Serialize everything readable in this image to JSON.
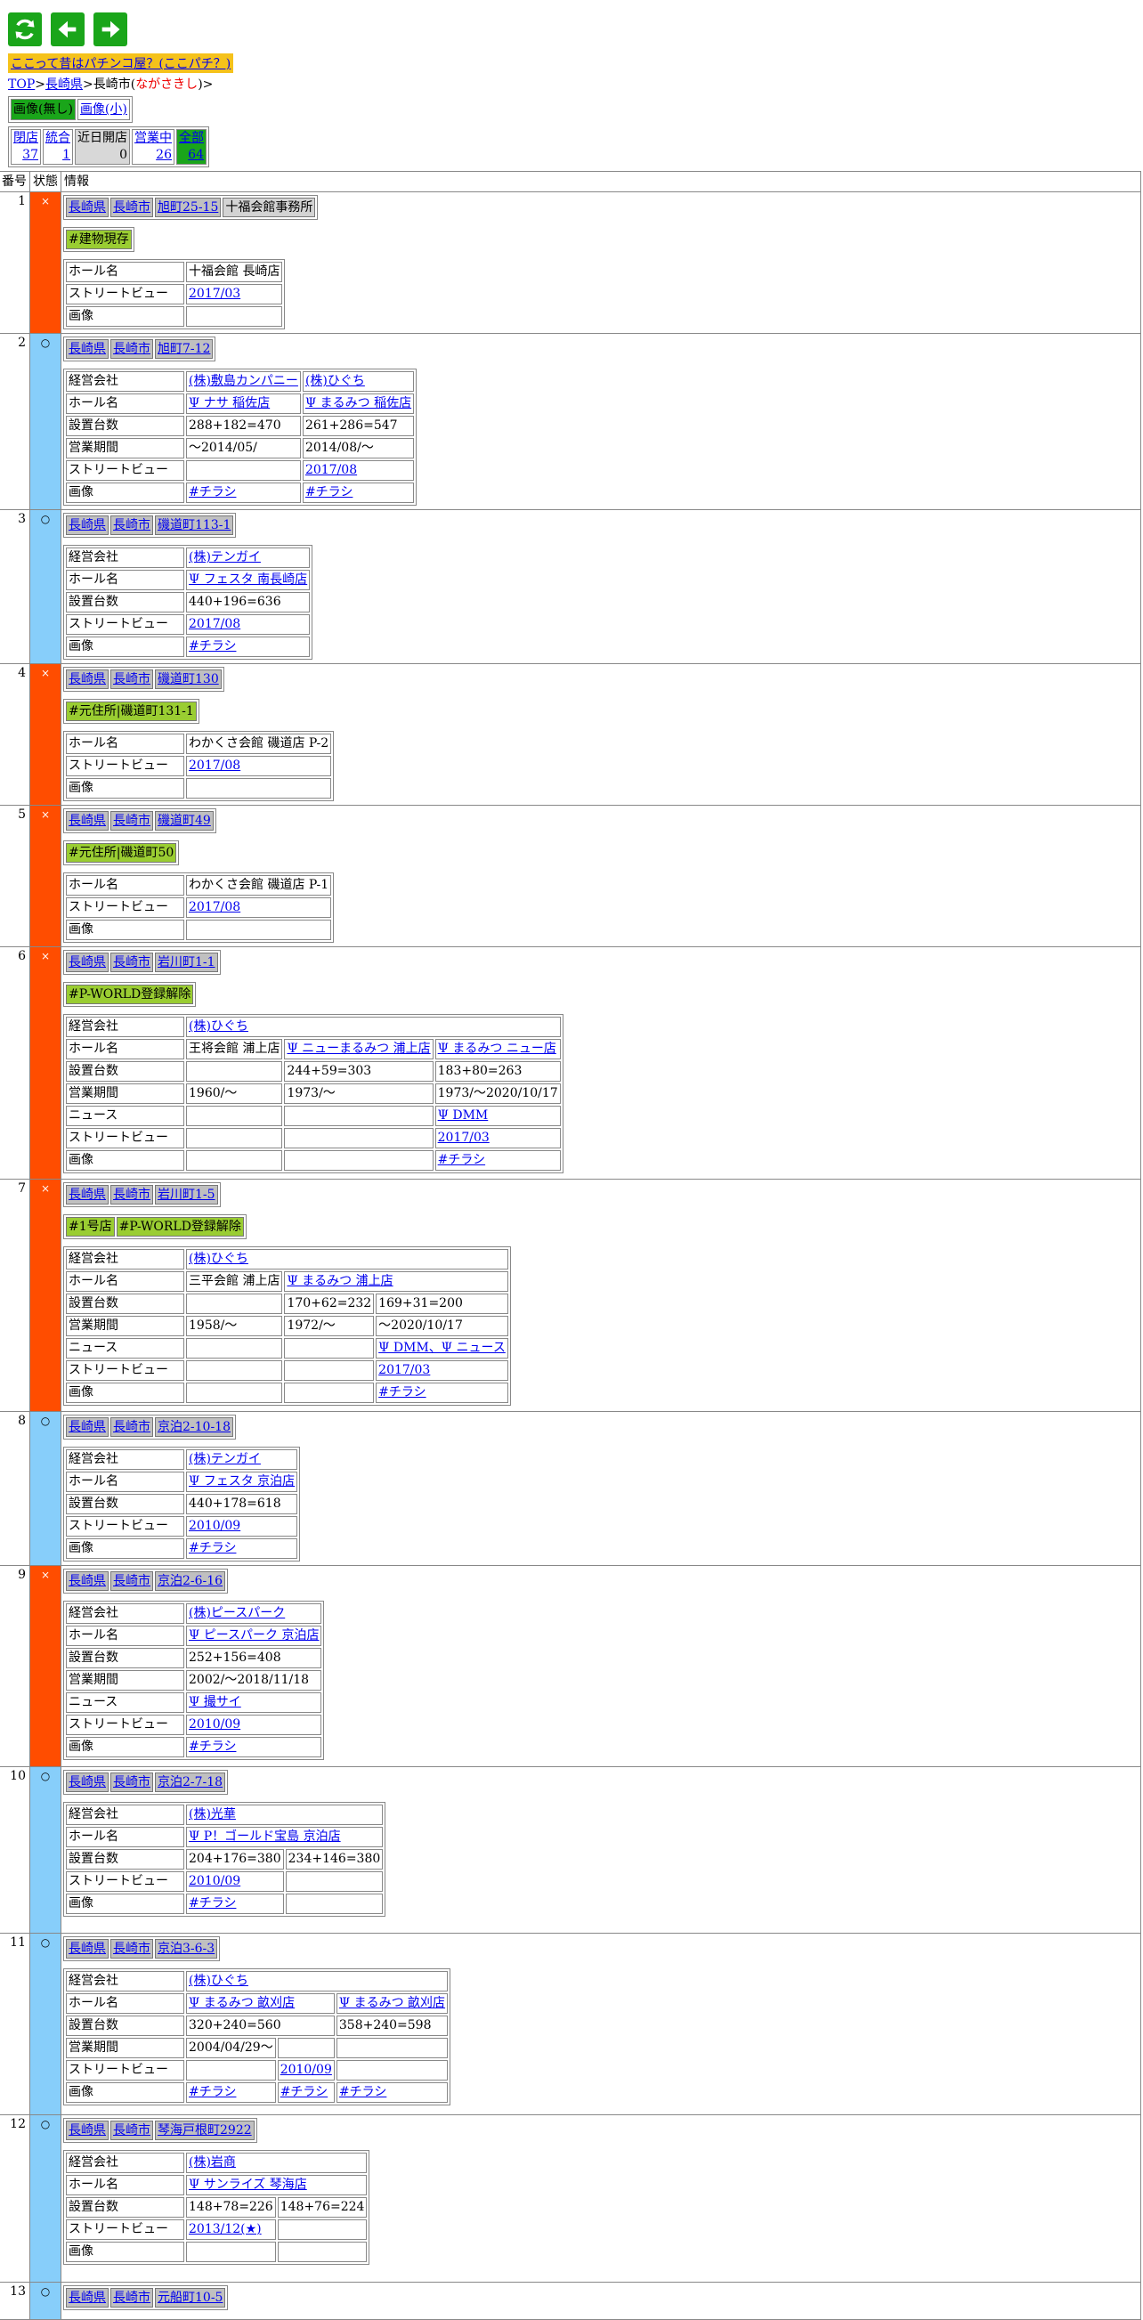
{
  "banner": "ここって昔はパチンコ屋？(ここパチ？)",
  "breadcrumb": {
    "top": "TOP",
    "sep1": ">",
    "pref": "長崎県",
    "sep2": ">",
    "city": "長崎市(",
    "reading": "ながさきし",
    "close": ")>"
  },
  "image_toggle": {
    "none": "画像(無し)",
    "small": "画像(小)"
  },
  "stats": [
    {
      "label": "閉店",
      "value": "37",
      "link": true,
      "style": "plain"
    },
    {
      "label": "統合",
      "value": "1",
      "link": true,
      "style": "plain"
    },
    {
      "label": "近日開店",
      "value": "0",
      "link": false,
      "style": "gray"
    },
    {
      "label": "営業中",
      "value": "26",
      "link": true,
      "style": "plain"
    },
    {
      "label": "全部",
      "value": "64",
      "link": true,
      "style": "green"
    }
  ],
  "columns": {
    "no": "番号",
    "status": "状態",
    "info": "情報"
  },
  "labels": {
    "company": "経営会社",
    "hall": "ホール名",
    "machines": "設置台数",
    "period": "営業期間",
    "news": "ニュース",
    "street": "ストリートビュー",
    "image": "画像"
  },
  "status_symbols": {
    "closed": "×",
    "open": "○"
  },
  "rows": [
    {
      "no": "1",
      "status": "closed",
      "addr": [
        "長崎県",
        "長崎市",
        "旭町25-15"
      ],
      "addr_plain": "十福会館事務所",
      "tags": [
        "#建物現存"
      ],
      "details": [
        {
          "k": "hall",
          "v": [
            {
              "t": "十福会館 長崎店"
            }
          ]
        },
        {
          "k": "street",
          "v": [
            {
              "t": "2017/03",
              "a": true
            }
          ]
        },
        {
          "k": "image",
          "v": [
            {
              "t": ""
            }
          ]
        }
      ]
    },
    {
      "no": "2",
      "status": "open",
      "addr": [
        "長崎県",
        "長崎市",
        "旭町7-12"
      ],
      "tags": [],
      "details": [
        {
          "k": "company",
          "v": [
            {
              "t": "(株)敷島カンパニー",
              "a": true
            },
            {
              "t": "(株)ひぐち",
              "a": true
            }
          ]
        },
        {
          "k": "hall",
          "v": [
            {
              "t": "Ψ ナサ 稲佐店",
              "a": true
            },
            {
              "t": "Ψ まるみつ 稲佐店",
              "a": true
            }
          ]
        },
        {
          "k": "machines",
          "v": [
            {
              "t": "288+182=470"
            },
            {
              "t": "261+286=547"
            }
          ]
        },
        {
          "k": "period",
          "v": [
            {
              "t": "～2014/05/"
            },
            {
              "t": "2014/08/～"
            }
          ]
        },
        {
          "k": "street",
          "v": [
            {
              "t": ""
            },
            {
              "t": "2017/08",
              "a": true
            }
          ]
        },
        {
          "k": "image",
          "v": [
            {
              "t": "#チラシ",
              "a": true
            },
            {
              "t": "#チラシ",
              "a": true
            }
          ]
        }
      ]
    },
    {
      "no": "3",
      "status": "open",
      "addr": [
        "長崎県",
        "長崎市",
        "磯道町113-1"
      ],
      "tags": [],
      "details": [
        {
          "k": "company",
          "v": [
            {
              "t": "(株)テンガイ",
              "a": true
            }
          ]
        },
        {
          "k": "hall",
          "v": [
            {
              "t": "Ψ フェスタ 南長崎店",
              "a": true
            }
          ]
        },
        {
          "k": "machines",
          "v": [
            {
              "t": "440+196=636"
            }
          ]
        },
        {
          "k": "street",
          "v": [
            {
              "t": "2017/08",
              "a": true
            }
          ]
        },
        {
          "k": "image",
          "v": [
            {
              "t": "#チラシ",
              "a": true
            }
          ]
        }
      ]
    },
    {
      "no": "4",
      "status": "closed",
      "addr": [
        "長崎県",
        "長崎市",
        "磯道町130"
      ],
      "tags": [
        "#元住所|磯道町131-1"
      ],
      "details": [
        {
          "k": "hall",
          "v": [
            {
              "t": "わかくさ会館 磯道店 P-2"
            }
          ]
        },
        {
          "k": "street",
          "v": [
            {
              "t": "2017/08",
              "a": true
            }
          ]
        },
        {
          "k": "image",
          "v": [
            {
              "t": ""
            }
          ]
        }
      ]
    },
    {
      "no": "5",
      "status": "closed",
      "addr": [
        "長崎県",
        "長崎市",
        "磯道町49"
      ],
      "tags": [
        "#元住所|磯道町50"
      ],
      "details": [
        {
          "k": "hall",
          "v": [
            {
              "t": "わかくさ会館 磯道店 P-1"
            }
          ]
        },
        {
          "k": "street",
          "v": [
            {
              "t": "2017/08",
              "a": true
            }
          ]
        },
        {
          "k": "image",
          "v": [
            {
              "t": ""
            }
          ]
        }
      ]
    },
    {
      "no": "6",
      "status": "closed",
      "addr": [
        "長崎県",
        "長崎市",
        "岩川町1-1"
      ],
      "tags": [
        "#P-WORLD登録解除"
      ],
      "details": [
        {
          "k": "company",
          "v": [
            {
              "t": "(株)ひぐち",
              "a": true,
              "span": 3
            }
          ]
        },
        {
          "k": "hall",
          "v": [
            {
              "t": "王将会館 浦上店"
            },
            {
              "t": "Ψ ニューまるみつ 浦上店",
              "a": true
            },
            {
              "t": "Ψ まるみつ ニュー店",
              "a": true
            }
          ]
        },
        {
          "k": "machines",
          "v": [
            {
              "t": ""
            },
            {
              "t": "244+59=303"
            },
            {
              "t": "183+80=263"
            }
          ]
        },
        {
          "k": "period",
          "v": [
            {
              "t": "1960/～"
            },
            {
              "t": "1973/～"
            },
            {
              "t": "1973/～2020/10/17"
            }
          ]
        },
        {
          "k": "news",
          "v": [
            {
              "t": ""
            },
            {
              "t": ""
            },
            {
              "t": "Ψ DMM",
              "a": true
            }
          ]
        },
        {
          "k": "street",
          "v": [
            {
              "t": ""
            },
            {
              "t": ""
            },
            {
              "t": "2017/03",
              "a": true
            }
          ]
        },
        {
          "k": "image",
          "v": [
            {
              "t": ""
            },
            {
              "t": ""
            },
            {
              "t": "#チラシ",
              "a": true
            }
          ]
        }
      ]
    },
    {
      "no": "7",
      "status": "closed",
      "addr": [
        "長崎県",
        "長崎市",
        "岩川町1-5"
      ],
      "tags": [
        "#1号店",
        "#P-WORLD登録解除"
      ],
      "details": [
        {
          "k": "company",
          "v": [
            {
              "t": "(株)ひぐち",
              "a": true,
              "span": 3
            }
          ]
        },
        {
          "k": "hall",
          "v": [
            {
              "t": "三平会館 浦上店"
            },
            {
              "t": "Ψ まるみつ 浦上店",
              "a": true,
              "span": 2
            }
          ]
        },
        {
          "k": "machines",
          "v": [
            {
              "t": ""
            },
            {
              "t": "170+62=232"
            },
            {
              "t": "169+31=200"
            }
          ]
        },
        {
          "k": "period",
          "v": [
            {
              "t": "1958/～"
            },
            {
              "t": "1972/～"
            },
            {
              "t": "～2020/10/17"
            }
          ]
        },
        {
          "k": "news",
          "v": [
            {
              "t": ""
            },
            {
              "t": ""
            },
            {
              "t": "Ψ DMM、Ψ ニュース",
              "a": true
            }
          ]
        },
        {
          "k": "street",
          "v": [
            {
              "t": ""
            },
            {
              "t": ""
            },
            {
              "t": "2017/03",
              "a": true
            }
          ]
        },
        {
          "k": "image",
          "v": [
            {
              "t": ""
            },
            {
              "t": ""
            },
            {
              "t": "#チラシ",
              "a": true
            }
          ]
        }
      ]
    },
    {
      "no": "8",
      "status": "open",
      "addr": [
        "長崎県",
        "長崎市",
        "京泊2-10-18"
      ],
      "tags": [],
      "details": [
        {
          "k": "company",
          "v": [
            {
              "t": "(株)テンガイ",
              "a": true
            }
          ]
        },
        {
          "k": "hall",
          "v": [
            {
              "t": "Ψ フェスタ 京泊店",
              "a": true
            }
          ]
        },
        {
          "k": "machines",
          "v": [
            {
              "t": "440+178=618"
            }
          ]
        },
        {
          "k": "street",
          "v": [
            {
              "t": "2010/09",
              "a": true
            }
          ]
        },
        {
          "k": "image",
          "v": [
            {
              "t": "#チラシ",
              "a": true
            }
          ]
        }
      ]
    },
    {
      "no": "9",
      "status": "closed",
      "addr": [
        "長崎県",
        "長崎市",
        "京泊2-6-16"
      ],
      "tags": [],
      "details": [
        {
          "k": "company",
          "v": [
            {
              "t": "(株)ピースパーク",
              "a": true
            }
          ]
        },
        {
          "k": "hall",
          "v": [
            {
              "t": "Ψ ピースパーク 京泊店",
              "a": true
            }
          ]
        },
        {
          "k": "machines",
          "v": [
            {
              "t": "252+156=408"
            }
          ]
        },
        {
          "k": "period",
          "v": [
            {
              "t": "2002/～2018/11/18"
            }
          ]
        },
        {
          "k": "news",
          "v": [
            {
              "t": "Ψ 撮サイ",
              "a": true
            }
          ]
        },
        {
          "k": "street",
          "v": [
            {
              "t": "2010/09",
              "a": true
            }
          ]
        },
        {
          "k": "image",
          "v": [
            {
              "t": "#チラシ",
              "a": true
            }
          ]
        }
      ]
    },
    {
      "no": "10",
      "status": "open",
      "addr": [
        "長崎県",
        "長崎市",
        "京泊2-7-18"
      ],
      "tags": [],
      "details": [
        {
          "k": "company",
          "v": [
            {
              "t": "(株)光華",
              "a": true,
              "span": 2
            }
          ]
        },
        {
          "k": "hall",
          "v": [
            {
              "t": "Ψ P！ゴールド宝島 京泊店",
              "a": true,
              "span": 2
            }
          ]
        },
        {
          "k": "machines",
          "v": [
            {
              "t": "204+176=380"
            },
            {
              "t": "234+146=380"
            }
          ]
        },
        {
          "k": "street",
          "v": [
            {
              "t": "2010/09",
              "a": true
            },
            {
              "t": ""
            }
          ]
        },
        {
          "k": "image",
          "v": [
            {
              "t": "#チラシ",
              "a": true
            },
            {
              "t": ""
            }
          ]
        }
      ]
    },
    {
      "no": "11",
      "status": "open",
      "addr": [
        "長崎県",
        "長崎市",
        "京泊3-6-3"
      ],
      "tags": [],
      "details": [
        {
          "k": "company",
          "v": [
            {
              "t": "(株)ひぐち",
              "a": true,
              "span": 3
            }
          ]
        },
        {
          "k": "hall",
          "v": [
            {
              "t": "Ψ まるみつ 畝刈店",
              "a": true,
              "span": 2
            },
            {
              "t": "Ψ まるみつ 畝刈店",
              "a": true
            }
          ]
        },
        {
          "k": "machines",
          "v": [
            {
              "t": "320+240=560",
              "span": 2
            },
            {
              "t": "358+240=598"
            }
          ]
        },
        {
          "k": "period",
          "v": [
            {
              "t": "2004/04/29～"
            },
            {
              "t": ""
            },
            {
              "t": ""
            }
          ]
        },
        {
          "k": "street",
          "v": [
            {
              "t": ""
            },
            {
              "t": "2010/09",
              "a": true
            },
            {
              "t": ""
            }
          ]
        },
        {
          "k": "image",
          "v": [
            {
              "t": "#チラシ",
              "a": true
            },
            {
              "t": "#チラシ",
              "a": true
            },
            {
              "t": "#チラシ",
              "a": true
            }
          ]
        }
      ]
    },
    {
      "no": "12",
      "status": "open",
      "addr": [
        "長崎県",
        "長崎市",
        "琴海戸根町2922"
      ],
      "tags": [],
      "details": [
        {
          "k": "company",
          "v": [
            {
              "t": "(株)岩商",
              "a": true,
              "span": 2
            }
          ]
        },
        {
          "k": "hall",
          "v": [
            {
              "t": "Ψ サンライズ 琴海店",
              "a": true,
              "span": 2
            }
          ]
        },
        {
          "k": "machines",
          "v": [
            {
              "t": "148+78=226"
            },
            {
              "t": "148+76=224"
            }
          ]
        },
        {
          "k": "street",
          "v": [
            {
              "t": "2013/12(★)",
              "a": true
            },
            {
              "t": ""
            }
          ]
        },
        {
          "k": "image",
          "v": [
            {
              "t": ""
            },
            {
              "t": ""
            }
          ]
        }
      ]
    },
    {
      "no": "13",
      "status": "open",
      "addr": [
        "長崎県",
        "長崎市",
        "元船町10-5"
      ],
      "tags": [],
      "details": []
    }
  ]
}
